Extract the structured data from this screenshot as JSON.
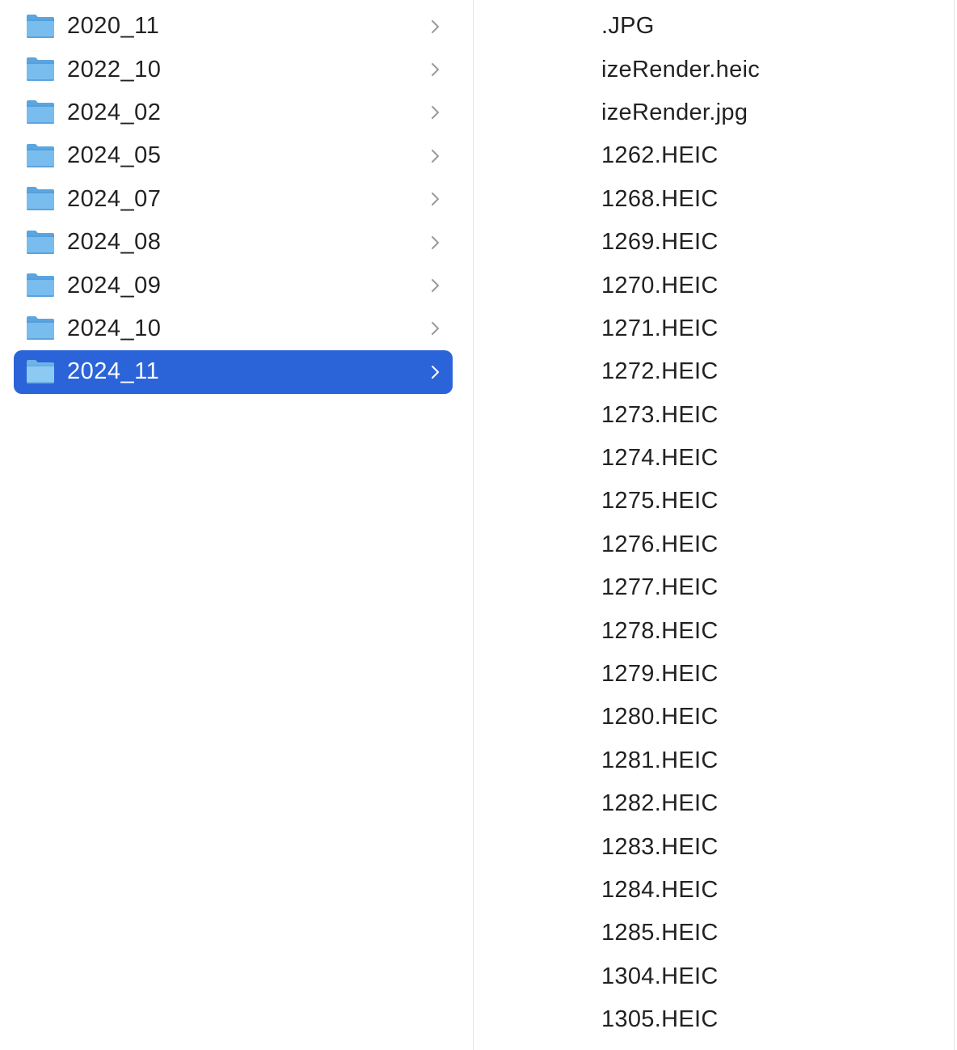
{
  "folders": [
    {
      "label": "2020_11",
      "selected": false
    },
    {
      "label": "2022_10",
      "selected": false
    },
    {
      "label": "2024_02",
      "selected": false
    },
    {
      "label": "2024_05",
      "selected": false
    },
    {
      "label": "2024_07",
      "selected": false
    },
    {
      "label": "2024_08",
      "selected": false
    },
    {
      "label": "2024_09",
      "selected": false
    },
    {
      "label": "2024_10",
      "selected": false
    },
    {
      "label": "2024_11",
      "selected": true
    }
  ],
  "files": [
    {
      "label": ".JPG"
    },
    {
      "label": "izeRender.heic"
    },
    {
      "label": "izeRender.jpg"
    },
    {
      "label": "1262.HEIC"
    },
    {
      "label": "1268.HEIC"
    },
    {
      "label": "1269.HEIC"
    },
    {
      "label": "1270.HEIC"
    },
    {
      "label": "1271.HEIC"
    },
    {
      "label": "1272.HEIC"
    },
    {
      "label": "1273.HEIC"
    },
    {
      "label": "1274.HEIC"
    },
    {
      "label": "1275.HEIC"
    },
    {
      "label": "1276.HEIC"
    },
    {
      "label": "1277.HEIC"
    },
    {
      "label": "1278.HEIC"
    },
    {
      "label": "1279.HEIC"
    },
    {
      "label": "1280.HEIC"
    },
    {
      "label": "1281.HEIC"
    },
    {
      "label": "1282.HEIC"
    },
    {
      "label": "1283.HEIC"
    },
    {
      "label": "1284.HEIC"
    },
    {
      "label": "1285.HEIC"
    },
    {
      "label": "1304.HEIC"
    },
    {
      "label": "1305.HEIC"
    }
  ],
  "colors": {
    "selection": "#2b63d9",
    "folder_icon": "#6fb6ea",
    "text": "#222222",
    "chevron": "#9a9a9a"
  },
  "icons": {
    "folder": "folder-icon",
    "chevron": "chevron-right-icon"
  }
}
